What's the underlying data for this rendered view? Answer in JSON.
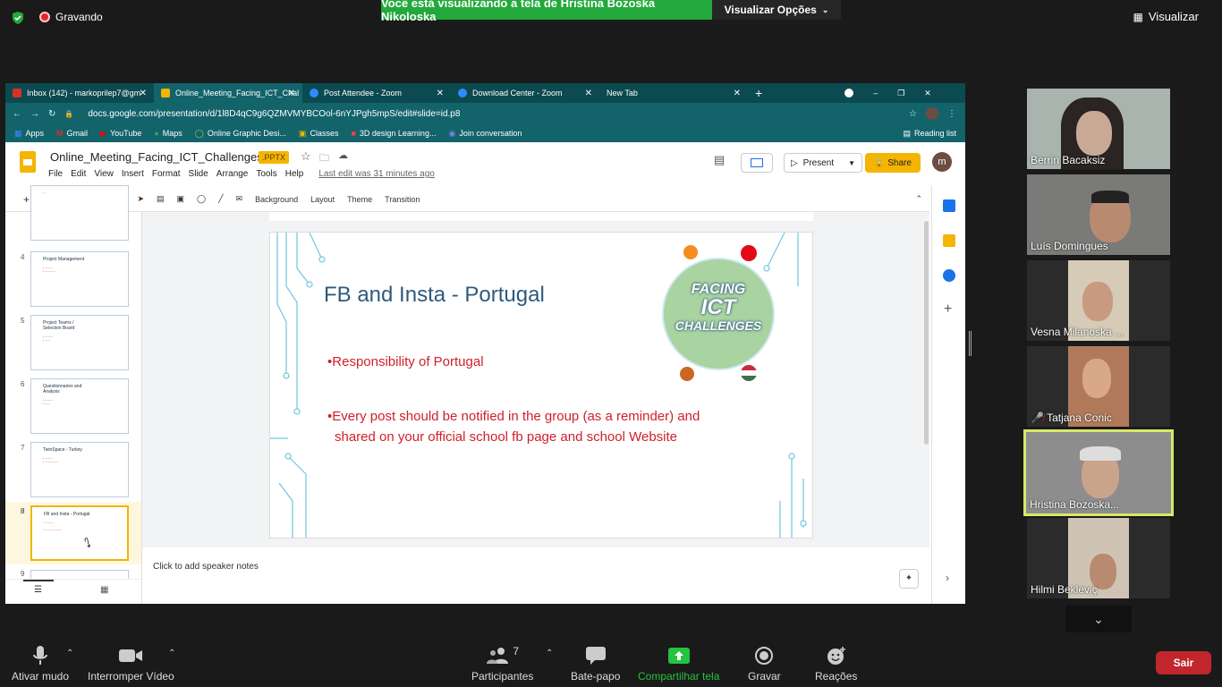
{
  "zoom": {
    "recording_label": "Gravando",
    "share_banner": "Você está visualizando a tela de Hristina Bozoska Nikoloska",
    "view_options": "Visualizar Opções",
    "view_button": "Visualizar"
  },
  "browser": {
    "tabs": [
      {
        "label": "Inbox (142) - markoprilep7@gm",
        "color": "#d93025"
      },
      {
        "label": "Online_Meeting_Facing_ICT_Chal",
        "color": "#f5b400"
      },
      {
        "label": "Post Attendee - Zoom",
        "color": "#2d8cff"
      },
      {
        "label": "Download Center - Zoom",
        "color": "#2d8cff"
      },
      {
        "label": "New Tab",
        "color": ""
      }
    ],
    "url": "docs.google.com/presentation/d/1l8D4qC9g6QZMVMYBCOol-6nYJPgh5mpS/edit#slide=id.p8",
    "bookmarks": [
      "Apps",
      "Gmail",
      "YouTube",
      "Maps",
      "Online Graphic Desi...",
      "Classes",
      "3D design Learning...",
      "Join conversation"
    ],
    "reading_list": "Reading list"
  },
  "slides": {
    "doc_title": "Online_Meeting_Facing_ICT_Challenges",
    "badge": ".PPTX",
    "menu": [
      "File",
      "Edit",
      "View",
      "Insert",
      "Format",
      "Slide",
      "Arrange",
      "Tools",
      "Help"
    ],
    "last_edit": "Last edit was 31 minutes ago",
    "present": "Present",
    "share": "Share",
    "avatar_letter": "m",
    "toolbar": [
      "Background",
      "Layout",
      "Theme",
      "Transition"
    ],
    "thumbnails": [
      {
        "num": "4",
        "title": "Project Management"
      },
      {
        "num": "5",
        "title": "Project Teams / Selection Board"
      },
      {
        "num": "6",
        "title": "Questionnaires and Analysis"
      },
      {
        "num": "7",
        "title": "TwinSpace - Turkey"
      },
      {
        "num": "8",
        "title": "FB and Insta - Portugal"
      },
      {
        "num": "9",
        "title": ""
      }
    ],
    "slide": {
      "title": "FB and Insta - Portugal",
      "bullet1": "Responsibility of Portugal",
      "bullet2_line1": "Every post should be notified in the group (as a reminder) and",
      "bullet2_line2": "shared on your official school fb page and school Website",
      "logo_line1": "FACING",
      "logo_line2": "ICT",
      "logo_line3": "CHALLENGES"
    },
    "notes_placeholder": "Click to add speaker notes"
  },
  "participants": [
    {
      "name": "Berrin Bacaksiz"
    },
    {
      "name": "Luís Domingues"
    },
    {
      "name": "Vesna Milanoska ..."
    },
    {
      "name": "Tatjana Conic"
    },
    {
      "name": "Hristina Bozoska..."
    },
    {
      "name": "Hilmi Bekleviç"
    }
  ],
  "controls": {
    "mute": "Ativar mudo",
    "video": "Interromper Vídeo",
    "participants": "Participantes",
    "participants_count": "7",
    "chat": "Bate-papo",
    "share": "Compartilhar tela",
    "record": "Gravar",
    "reactions": "Reações",
    "leave": "Sair"
  }
}
